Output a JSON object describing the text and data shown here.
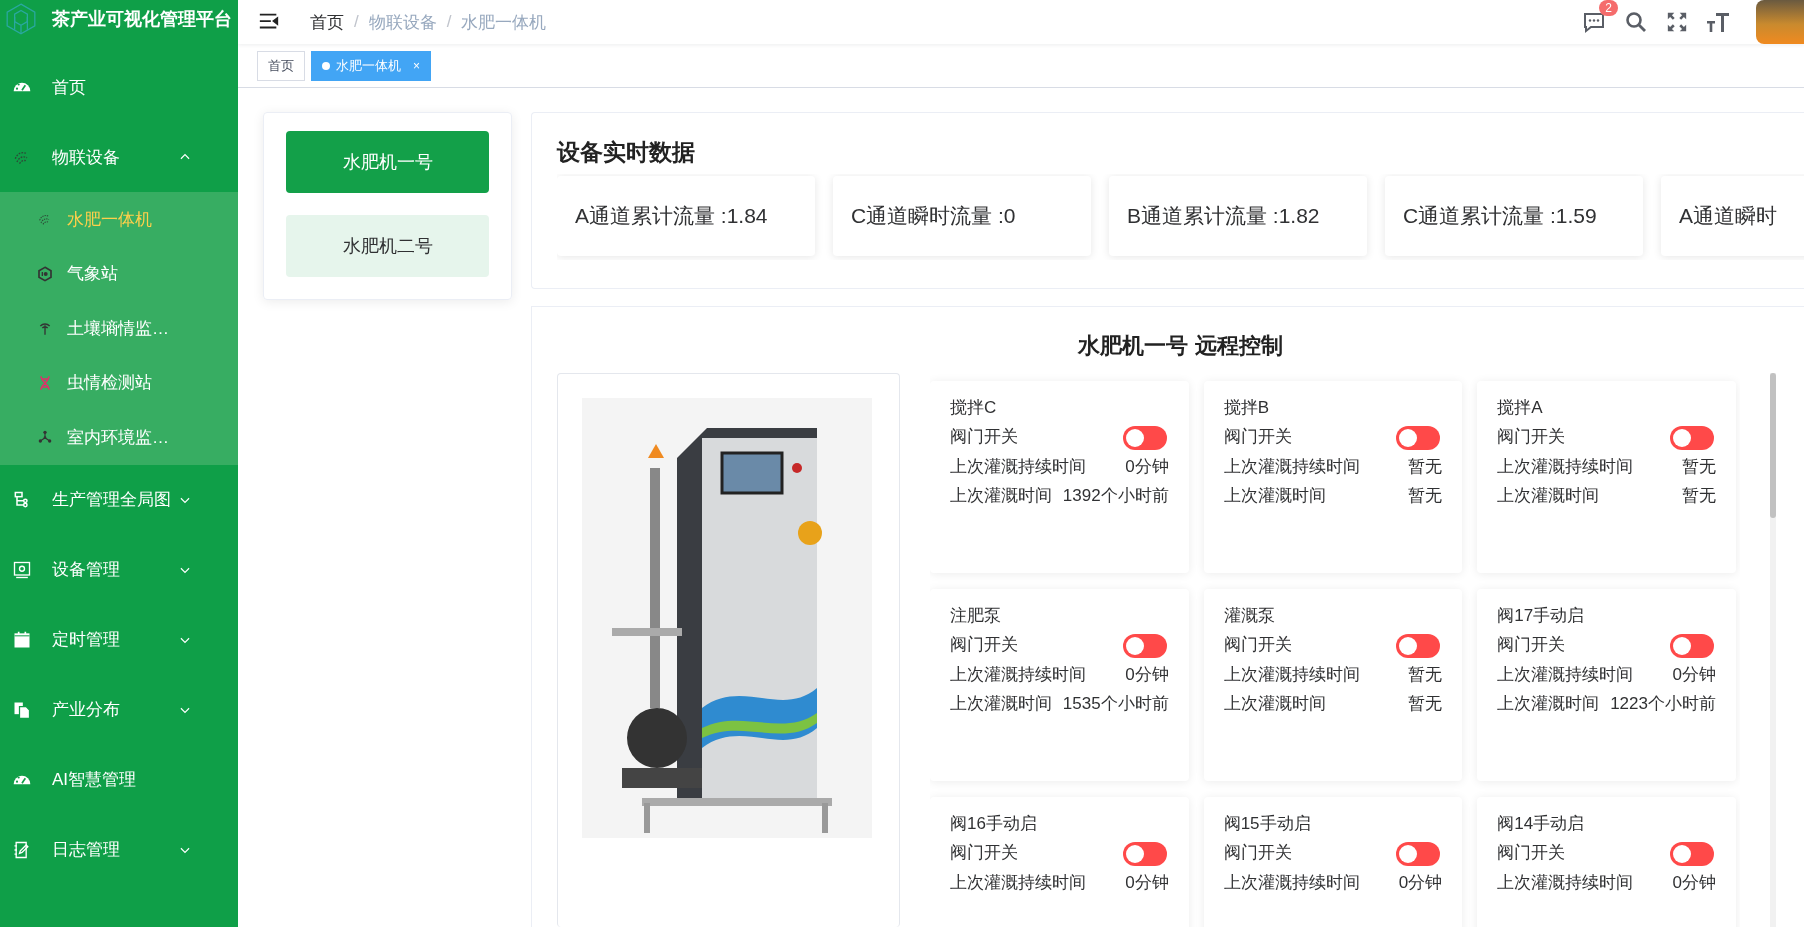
{
  "sidebar": {
    "title": "茶产业可视化管理平台",
    "items": [
      {
        "kind": "link",
        "label": "首页",
        "selected": false
      },
      {
        "kind": "group",
        "label": "物联设备",
        "selected": false,
        "expanded": true,
        "children": [
          {
            "label": "水肥一体机",
            "selected": true
          },
          {
            "label": "气象站",
            "selected": false
          },
          {
            "label": "土壤墒情监…",
            "selected": false
          },
          {
            "label": "虫情检测站",
            "selected": false
          },
          {
            "label": "室内环境监…",
            "selected": false
          }
        ]
      },
      {
        "kind": "group",
        "label": "生产管理全局图",
        "selected": false,
        "expanded": false
      },
      {
        "kind": "group",
        "label": "设备管理",
        "selected": false,
        "expanded": false
      },
      {
        "kind": "group",
        "label": "定时管理",
        "selected": false,
        "expanded": false
      },
      {
        "kind": "group",
        "label": "产业分布",
        "selected": false,
        "expanded": false
      },
      {
        "kind": "link",
        "label": "AI智慧管理",
        "selected": false
      },
      {
        "kind": "group",
        "label": "日志管理",
        "selected": false,
        "expanded": false
      }
    ]
  },
  "header": {
    "separator": "/",
    "breadcrumb": [
      {
        "label": "首页",
        "link": true
      },
      {
        "label": "物联设备",
        "link": false
      },
      {
        "label": "水肥一体机",
        "link": false
      }
    ],
    "message_count": "2"
  },
  "tags": [
    {
      "label": "首页",
      "selected": false
    },
    {
      "label": "水肥一体机",
      "selected": true,
      "close": "×"
    }
  ],
  "devices": [
    {
      "label": "水肥机一号",
      "selected": true
    },
    {
      "label": "水肥机二号",
      "selected": false
    }
  ],
  "realtime": {
    "title": "设备实时数据",
    "items": [
      "A通道累计流量 :1.84",
      "C通道瞬时流量 :0",
      "B通道累计流量 :1.82",
      "C通道累计流量 :1.59",
      "A通道瞬时"
    ]
  },
  "control": {
    "title": "水肥机一号 远程控制",
    "cards": [
      {
        "name": "搅拌C",
        "switch_label": "阀门开关",
        "on": false,
        "fields": [
          {
            "label": "上次灌溉持续时间",
            "value": "0分钟"
          },
          {
            "label": "上次灌溉时间",
            "value": "1392个小时前"
          }
        ]
      },
      {
        "name": "搅拌B",
        "switch_label": "阀门开关",
        "on": false,
        "fields": [
          {
            "label": "上次灌溉持续时间",
            "value": "暂无"
          },
          {
            "label": "上次灌溉时间",
            "value": "暂无"
          }
        ]
      },
      {
        "name": "搅拌A",
        "switch_label": "阀门开关",
        "on": false,
        "fields": [
          {
            "label": "上次灌溉持续时间",
            "value": "暂无"
          },
          {
            "label": "上次灌溉时间",
            "value": "暂无"
          }
        ]
      },
      {
        "name": "注肥泵",
        "switch_label": "阀门开关",
        "on": false,
        "fields": [
          {
            "label": "上次灌溉持续时间",
            "value": "0分钟"
          },
          {
            "label": "上次灌溉时间",
            "value": "1535个小时前"
          }
        ]
      },
      {
        "name": "灌溉泵",
        "switch_label": "阀门开关",
        "on": false,
        "fields": [
          {
            "label": "上次灌溉持续时间",
            "value": "暂无"
          },
          {
            "label": "上次灌溉时间",
            "value": "暂无"
          }
        ]
      },
      {
        "name": "阀17手动启",
        "switch_label": "阀门开关",
        "on": false,
        "fields": [
          {
            "label": "上次灌溉持续时间",
            "value": "0分钟"
          },
          {
            "label": "上次灌溉时间",
            "value": "1223个小时前"
          }
        ]
      },
      {
        "name": "阀16手动启",
        "switch_label": "阀门开关",
        "on": false,
        "fields": [
          {
            "label": "上次灌溉持续时间",
            "value": "0分钟"
          }
        ]
      },
      {
        "name": "阀15手动启",
        "switch_label": "阀门开关",
        "on": false,
        "fields": [
          {
            "label": "上次灌溉持续时间",
            "value": "0分钟"
          }
        ]
      },
      {
        "name": "阀14手动启",
        "switch_label": "阀门开关",
        "on": false,
        "fields": [
          {
            "label": "上次灌溉持续时间",
            "value": "0分钟"
          }
        ]
      }
    ]
  }
}
